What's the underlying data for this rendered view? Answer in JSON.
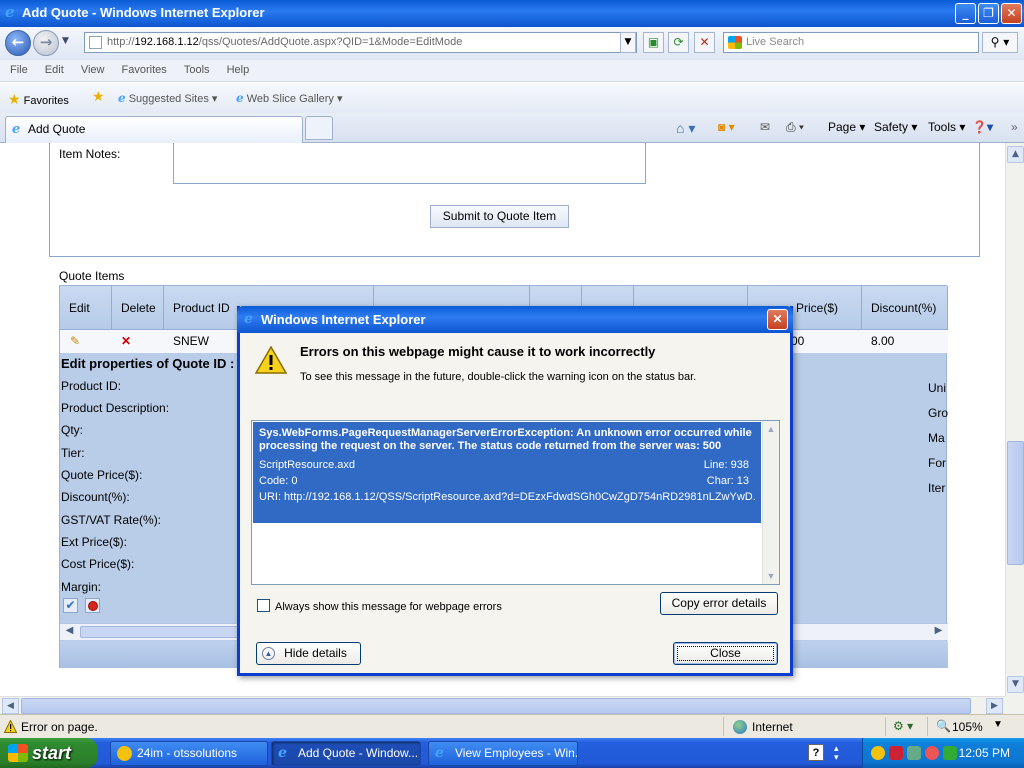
{
  "window": {
    "title": "Add Quote - Windows Internet Explorer",
    "minimize": "_",
    "restore": "❐",
    "close": "✕"
  },
  "address": {
    "url_prefix": "http://",
    "url_host": "192.168.1.12",
    "url_path": "/qss/Quotes/AddQuote.aspx?QID=1&Mode=EditMode",
    "search_placeholder": "Live Search"
  },
  "menu": [
    "File",
    "Edit",
    "View",
    "Favorites",
    "Tools",
    "Help"
  ],
  "favorites_bar": {
    "favorites": "Favorites",
    "suggested": "Suggested Sites ▾",
    "webslice": "Web Slice Gallery ▾"
  },
  "tab": {
    "label": "Add Quote"
  },
  "command_bar": {
    "page": "Page ▾",
    "safety": "Safety ▾",
    "tools": "Tools ▾"
  },
  "page": {
    "item_notes_label": "Item Notes:",
    "submit_button": "Submit to Quote Item",
    "quote_items_title": "Quote Items",
    "grid_headers": {
      "edit": "Edit",
      "delete": "Delete",
      "product_id": "Product ID",
      "price": "Price($)",
      "discount": "Discount(%)"
    },
    "row": {
      "product_id": "SNEW",
      "price": "00",
      "discount": "8.00"
    },
    "edit_props_title": "Edit properties of Quote ID :",
    "prop_labels": [
      "Product ID:",
      "Product Description:",
      "Qty:",
      "Tier:",
      "Quote Price($):",
      "Discount(%):",
      "GST/VAT Rate(%):",
      "Ext Price($):",
      "Cost Price($):",
      "Margin:"
    ],
    "right_labels": [
      "Uni",
      "Gro",
      "Ma",
      "For",
      "Iter"
    ]
  },
  "dialog": {
    "title": "Windows Internet Explorer",
    "heading": "Errors on this webpage might cause it to work incorrectly",
    "subtext": "To see this message in the future, double-click the warning icon on the status bar.",
    "error_message": "Sys.WebForms.PageRequestManagerServerErrorException: An unknown error occurred while processing the request on the server. The status code returned from the server was: 500",
    "file": "ScriptResource.axd",
    "line": "Line: 938",
    "code": "Code: 0",
    "char": "Char: 13",
    "uri": "URI: http://192.168.1.12/QSS/ScriptResource.axd?d=DEzxFdwdSGh0CwZgD754nRD2981nLZwYwD...",
    "always_show": "Always show this message for webpage errors",
    "copy_button": "Copy error details",
    "hide_button": "Hide details",
    "close_button": "Close"
  },
  "status": {
    "error_text": "Error on page.",
    "zone": "Internet",
    "zoom": "105%"
  },
  "taskbar": {
    "start": "start",
    "tasks": [
      "24im - otssolutions",
      "Add Quote - Window...",
      "View Employees - Win..."
    ],
    "lang": "?",
    "clock": "12:05 PM"
  },
  "colors": {
    "titlebar": "#0a5bd6",
    "selection": "#316ac5",
    "grid_bg": "#b9cde9",
    "taskbar": "#245edc",
    "start": "#2f8a2f"
  }
}
